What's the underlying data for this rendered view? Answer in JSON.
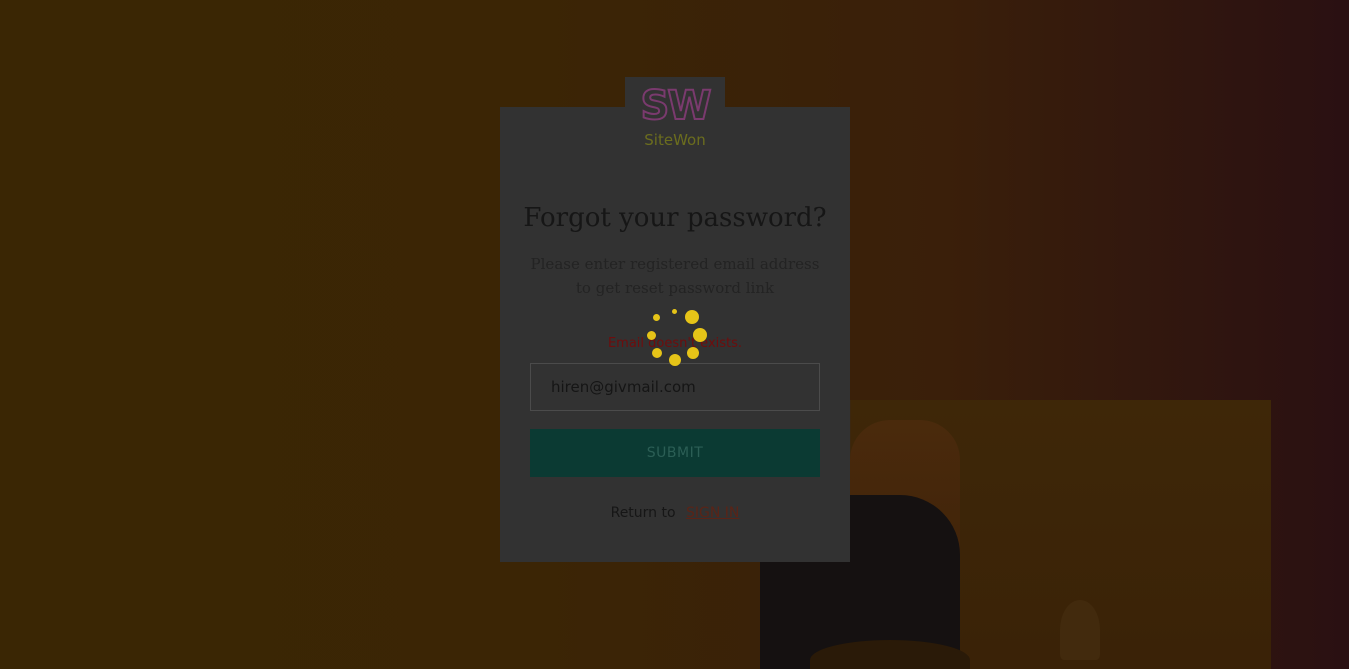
{
  "brand": {
    "logo_mark": "SW",
    "logo_word": "SiteWon"
  },
  "form": {
    "title": "Forgot your password?",
    "subtitle": "Please enter registered email address to get reset password link",
    "error_message": "Email doesn't exists.",
    "email_value": "hiren@givmail.com",
    "submit_label": "SUBMIT",
    "return_text": "Return to",
    "signin_link": "SIGN IN"
  },
  "colors": {
    "card_bg": "#323232",
    "submit_bg": "#0b3a33",
    "error": "#6e0d0d",
    "spinner": "#e6c418"
  },
  "icons": {
    "loading": "loading-spinner-icon",
    "logo": "sitewon-logo-icon"
  }
}
